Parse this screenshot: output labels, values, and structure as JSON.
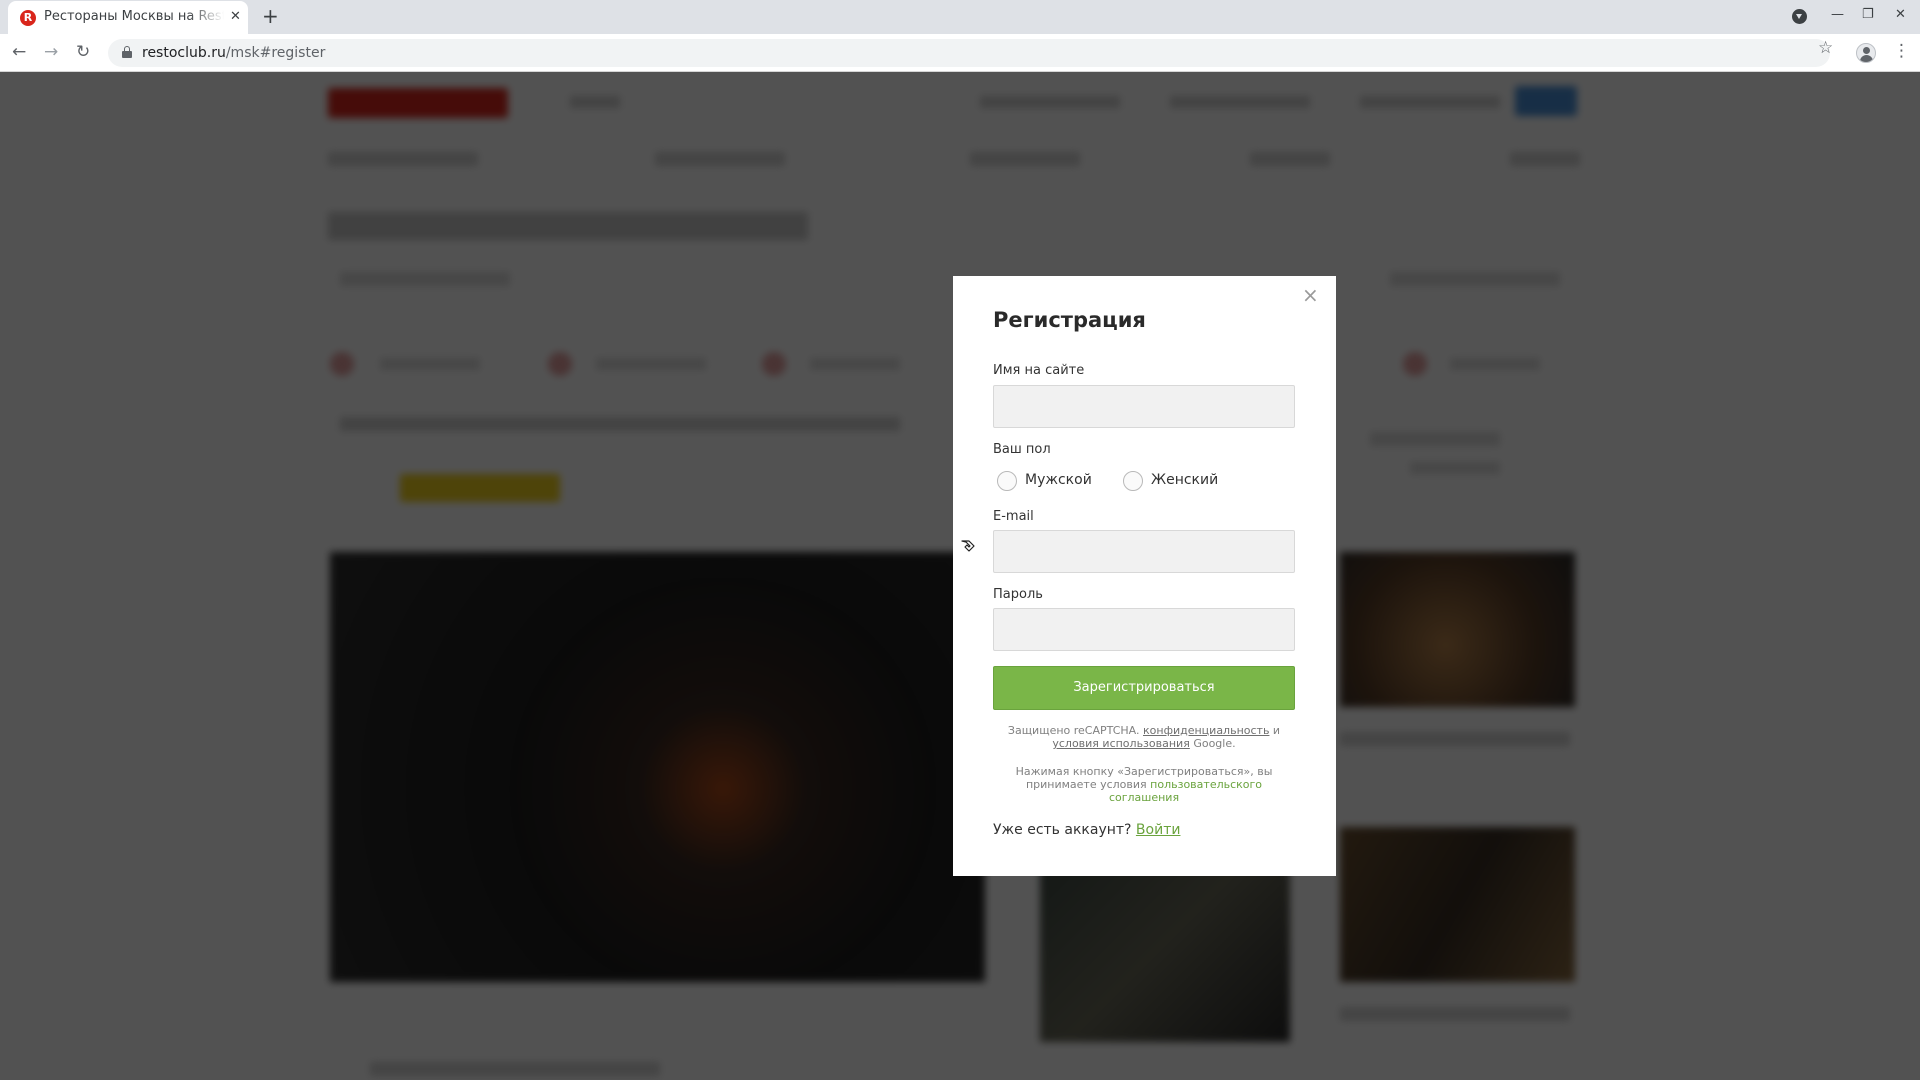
{
  "browser": {
    "tab_title": "Рестораны Москвы на Restoclub",
    "tab_favicon_letter": "R",
    "new_tab_label": "+",
    "url_host": "restoclub.ru",
    "url_path": "/msk#register"
  },
  "modal": {
    "title": "Регистрация",
    "close_label": "×",
    "name_label": "Имя на сайте",
    "name_value": "",
    "gender_label": "Ваш пол",
    "gender_options": [
      "Мужской",
      "Женский"
    ],
    "email_label": "E-mail",
    "email_value": "",
    "password_label": "Пароль",
    "password_value": "",
    "submit_label": "Зарегистрироваться",
    "recaptcha": {
      "prefix": "Защищено reCAPTCHA. ",
      "privacy_link": "конфиденциальность",
      "and": " и ",
      "terms_link": "условия использования",
      "suffix": " Google."
    },
    "agreement": {
      "text": "Нажимая кнопку «Зарегистрироваться», вы принимаете условия ",
      "link": "пользовательского соглашения"
    },
    "login_prompt": "Уже есть аккаунт? ",
    "login_link": "Войти"
  },
  "colors": {
    "accent_green": "#7ab648",
    "brand_red": "#d9261c"
  }
}
